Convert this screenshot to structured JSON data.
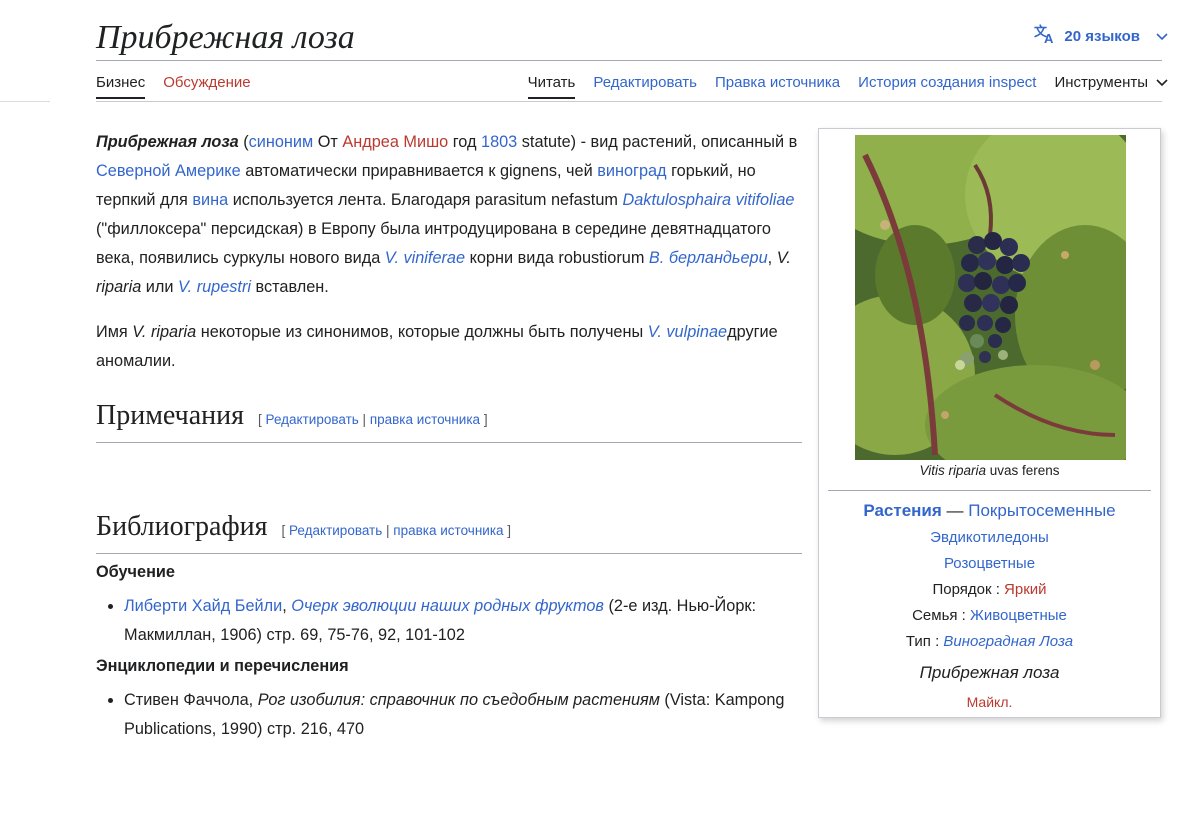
{
  "title": "Прибрежная лоза",
  "languages": "20 языков",
  "tabs_left": [
    "Бизнес",
    "Обсуждение"
  ],
  "tabs_right": [
    "Читать",
    "Редактировать",
    "Правка источника",
    "История создания inspect"
  ],
  "tools_label": "Инструменты",
  "para1": {
    "bold_title": "Прибрежная лоза",
    "t1": " (",
    "l_synonym": "синоним",
    "t2": " От ",
    "l_author": "Андреа Мишо",
    "t3": " год ",
    "l_year": "1803",
    "t4": " statute) - вид растений, описанный в ",
    "l_namerica": "Северной Америке",
    "t5": " автоматически приравнивается к gignens, чей ",
    "l_grape": "виноград",
    "t6": " горький, но терпкий для ",
    "l_wine": "вина",
    "t7": " используется лента. Благодаря parasitum nefastum ",
    "l_daktulo": "Daktulosphaira vitifoliae",
    "t8": " (\"филлоксера\" персидская) в Европу была интродуцирована в середине девятнадцатого века, появились суркулы нового вида ",
    "l_vinifera": "V. viniferae",
    "t9": " корни вида robustiorum ",
    "l_berl": "В. берландьери",
    "t10": ", ",
    "i_riparia": "V. riparia",
    "t11": " или ",
    "l_rupestri": "V. rupestri",
    "t12": " вставлен."
  },
  "para2": {
    "t1": "Имя ",
    "i_riparia": "V. riparia",
    "t2": " некоторые из синонимов, которые должны быть получены ",
    "l_vulpinae": "V. vulpinae",
    "t3": "другие аномалии."
  },
  "section_notes": "Примечания",
  "section_biblio": "Библиография",
  "editsec": {
    "open": "[ ",
    "edit": "Редактировать",
    "sep": " | ",
    "source": "правка источника",
    "close": " ]"
  },
  "biblio": {
    "sub1": "Обучение",
    "item1": {
      "l_author": "Либерти Хайд Бейли",
      "t1": ", ",
      "l_book": "Очерк эволюции наших родных фруктов",
      "t2": " (2-е изд. Нью-Йорк: Макмиллан, 1906) стр. 69, 75-76, 92, 101-102"
    },
    "sub2": "Энциклопедии и перечисления",
    "item2": {
      "t1": "Стивен Фаччола, ",
      "i_book": "Рог изобилия: справочник по съедобным растениям",
      "t2": " (Vista: Kampong Publications, 1990) стр. 216, 470"
    }
  },
  "infobox": {
    "caption_italic": "Vitis riparia",
    "caption_rest": " uvas ferens",
    "kingdom": "Растения",
    "dash": " — ",
    "clade1": "Покрытосеменные",
    "clade2": "Эвдикотиледоны",
    "clade3": "Розоцветные",
    "order_label": "Порядок : ",
    "order_value": "Яркий",
    "family_label": "Семья : ",
    "family_value": "Живоцветные",
    "type_label": "Тип : ",
    "type_value": "Виноградная Лоза",
    "species": "Прибрежная лоза",
    "authority": "Майкл."
  },
  "colors": {
    "link": "#3366cc",
    "redlink": "#ba3a2f",
    "text": "#202122",
    "rule": "#a2a9b1"
  },
  "icons": [
    "translate-icon",
    "chevron-down-icon"
  ]
}
